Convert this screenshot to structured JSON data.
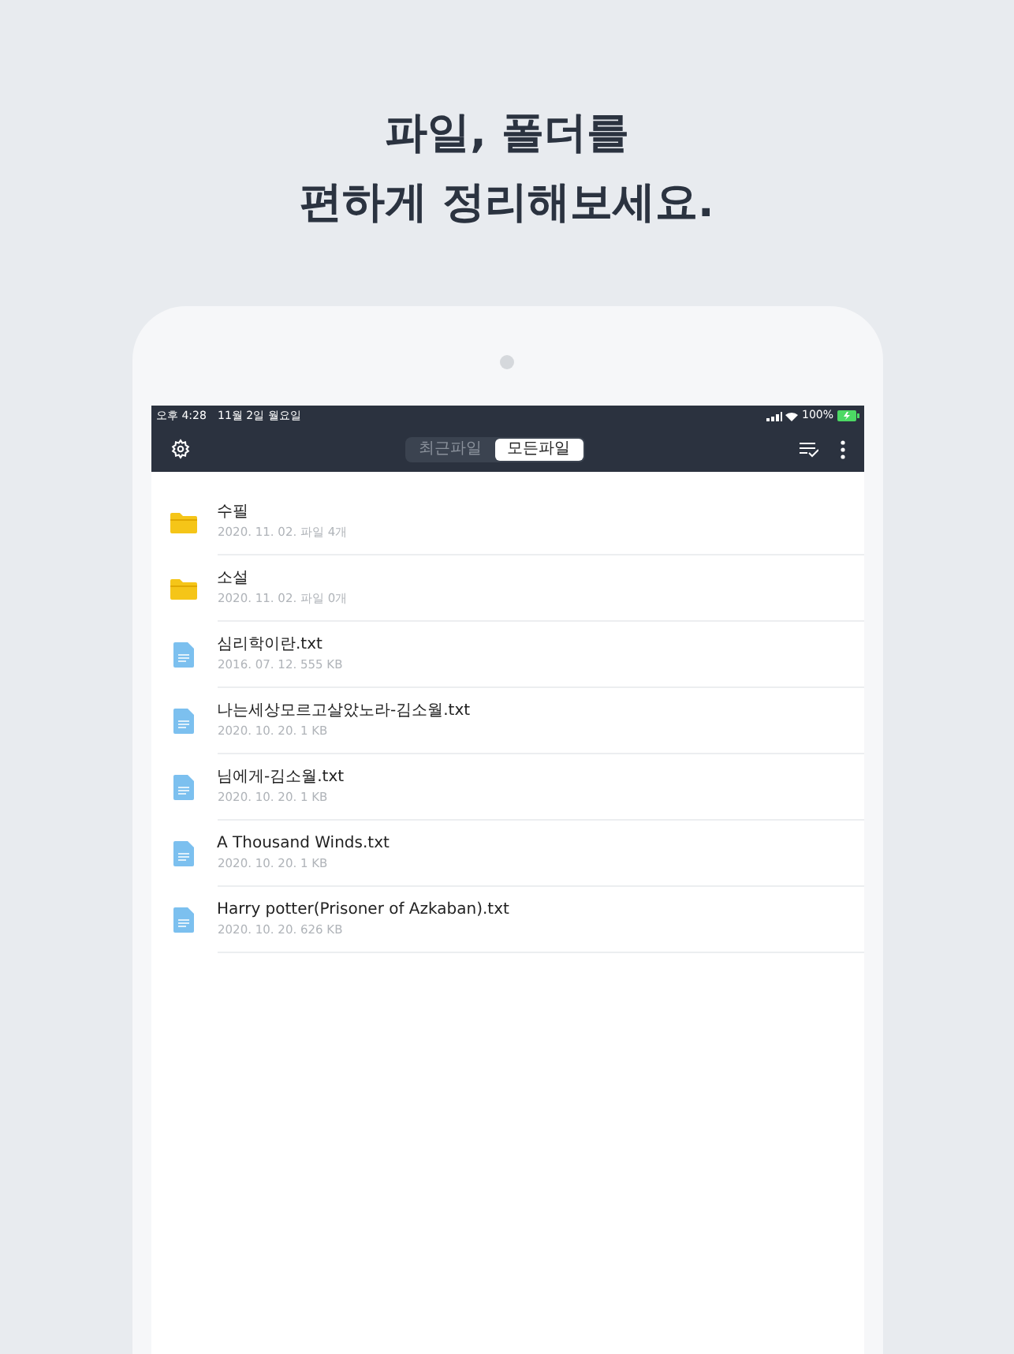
{
  "headline": [
    "파일, 폴더를",
    "편하게 정리해보세요."
  ],
  "status_bar": {
    "time": "오후 4:28",
    "date": "11월 2일 월요일",
    "battery": "100%"
  },
  "tabs": [
    {
      "label": "최근파일",
      "selected": false
    },
    {
      "label": "모든파일",
      "selected": true
    }
  ],
  "files": [
    {
      "kind": "folder",
      "name": "수필",
      "meta": "2020. 11. 02. 파일 4개"
    },
    {
      "kind": "folder",
      "name": "소설",
      "meta": "2020. 11. 02. 파일 0개"
    },
    {
      "kind": "text",
      "name": "심리학이란.txt",
      "meta": "2016. 07. 12. 555 KB"
    },
    {
      "kind": "text",
      "name": "나는세상모르고살았노라-김소월.txt",
      "meta": "2020. 10. 20. 1 KB"
    },
    {
      "kind": "text",
      "name": "님에게-김소월.txt",
      "meta": "2020. 10. 20. 1 KB"
    },
    {
      "kind": "text",
      "name": "A Thousand Winds.txt",
      "meta": "2020. 10. 20. 1 KB"
    },
    {
      "kind": "text",
      "name": "Harry potter(Prisoner of Azkaban).txt",
      "meta": "2020. 10. 20. 626 KB"
    }
  ]
}
